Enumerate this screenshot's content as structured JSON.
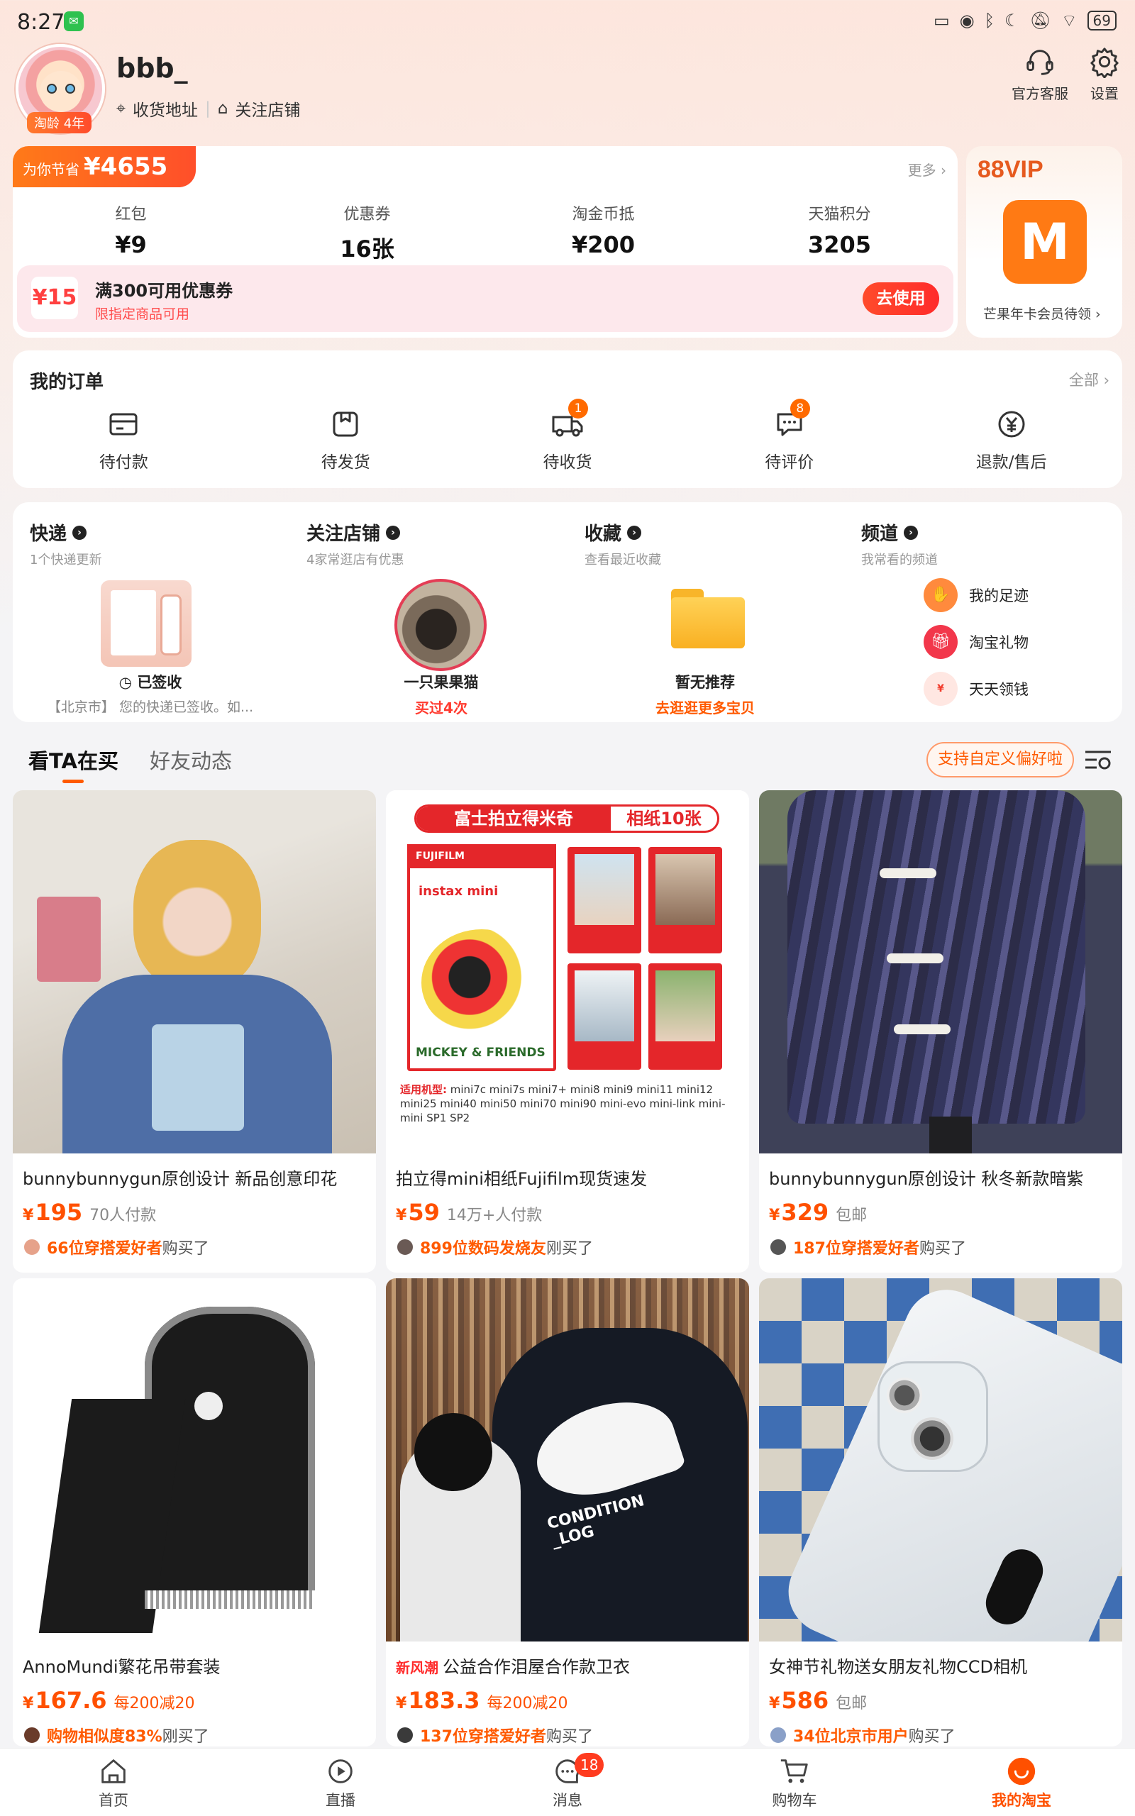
{
  "status_bar": {
    "time": "8:27",
    "battery": "69"
  },
  "profile": {
    "username": "bbb_",
    "age_badge": "淘龄 4年",
    "address_link": "收货地址",
    "follow_link": "关注店铺",
    "actions": [
      {
        "label": "官方客服",
        "icon": "headset-icon"
      },
      {
        "label": "设置",
        "icon": "gear-icon"
      }
    ]
  },
  "savings": {
    "label": "为你节省",
    "amount": "¥4655",
    "more": "更多 ›",
    "stats": [
      {
        "label": "红包",
        "value": "¥9"
      },
      {
        "label": "优惠券",
        "value": "16张"
      },
      {
        "label": "淘金币抵",
        "value": "¥200"
      },
      {
        "label": "天猫积分",
        "value": "3205"
      }
    ],
    "coupon": {
      "badge": "¥15",
      "title": "满300可用优惠券",
      "subtitle": "限指定商品可用",
      "button": "去使用"
    }
  },
  "vip": {
    "title": "88VIP",
    "subtitle": "芒果年卡会员待领 ›"
  },
  "orders": {
    "title": "我的订单",
    "all": "全部 ›",
    "items": [
      {
        "label": "待付款",
        "badge": ""
      },
      {
        "label": "待发货",
        "badge": ""
      },
      {
        "label": "待收货",
        "badge": "1"
      },
      {
        "label": "待评价",
        "badge": "8"
      },
      {
        "label": "退款/售后",
        "badge": ""
      }
    ]
  },
  "shortcuts": {
    "express": {
      "title": "快递",
      "subtitle": "1个快递更新",
      "status": "已签收",
      "note": "【北京市】 您的快递已签收。如..."
    },
    "shops": {
      "title": "关注店铺",
      "subtitle": "4家常逛店有优惠",
      "name": "一只果果猫",
      "note": "买过4次"
    },
    "favorites": {
      "title": "收藏",
      "subtitle": "查看最近收藏",
      "label": "暂无推荐",
      "note": "去逛逛更多宝贝"
    },
    "channels": {
      "title": "频道",
      "subtitle": "我常看的频道",
      "items": [
        "我的足迹",
        "淘宝礼物",
        "天天领钱"
      ]
    }
  },
  "feed": {
    "tabs": [
      "看TA在买",
      "好友动态"
    ],
    "preference_button": "支持自定义偏好啦",
    "products": [
      {
        "title": "bunnybunnygun原创设计 新品创意印花",
        "tag": "",
        "price": "195",
        "extra": "70人付款",
        "buyers_highlight": "66位穿搭爱好者",
        "buyers_suffix": "购买了"
      },
      {
        "title": "拍立得mini相纸Fujifilm现货速发",
        "tag": "",
        "price": "59",
        "extra": "14万+人付款",
        "buyers_highlight": "899位数码发烧友",
        "buyers_suffix": "刚买了"
      },
      {
        "title": "bunnybunnygun原创设计 秋冬新款暗紫",
        "tag": "",
        "price": "329",
        "extra": "包邮",
        "buyers_highlight": "187位穿搭爱好者",
        "buyers_suffix": "购买了"
      },
      {
        "title": "AnnoMundi繁花吊带套装",
        "tag": "",
        "price": "167.6",
        "extra": "每200减20",
        "buyers_highlight": "购物相似度83%",
        "buyers_suffix": "刚买了"
      },
      {
        "title": "公益合作泪屋合作款卫衣",
        "tag": "新风潮",
        "price": "183.3",
        "extra": "每200减20",
        "buyers_highlight": "137位穿搭爱好者",
        "buyers_suffix": "购买了"
      },
      {
        "title": "女神节礼物送女朋友礼物CCD相机",
        "tag": "",
        "price": "586",
        "extra": "包邮",
        "buyers_highlight": "34位北京市用户",
        "buyers_suffix": "购买了"
      }
    ],
    "instax_banner": {
      "headline": "富士拍立得米奇",
      "headline_right": "相纸10张",
      "brand": "FUJIFILM",
      "product": "instax mini",
      "box_title": "MICKEY & FRIENDS",
      "compat_label": "适用机型:",
      "compat_models": "mini7c mini7s mini7+ mini8 mini9 mini11 mini12 mini25 mini40 mini50 mini70 mini90 mini-evo mini-link mini-mini SP1 SP2"
    },
    "hoodie_print": "CONDITION _LOG"
  },
  "bottom_nav": {
    "items": [
      {
        "label": "首页",
        "badge": ""
      },
      {
        "label": "直播",
        "badge": ""
      },
      {
        "label": "消息",
        "badge": "18"
      },
      {
        "label": "购物车",
        "badge": ""
      },
      {
        "label": "我的淘宝",
        "badge": ""
      }
    ]
  },
  "colors": {
    "accent": "#ff5000",
    "vip": "#e65a1f",
    "mango": "#ff7a14"
  }
}
